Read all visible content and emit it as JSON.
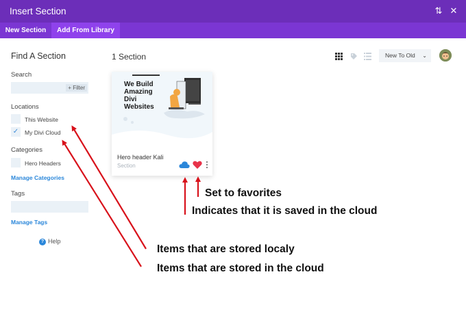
{
  "window": {
    "title": "Insert Section",
    "sort_icon": "⇅",
    "close_icon": "✕"
  },
  "tabs": [
    {
      "label": "New Section"
    },
    {
      "label": "Add From Library"
    }
  ],
  "sidebar": {
    "title": "Find A Section",
    "search_label": "Search",
    "search_value": "",
    "filter_label": "+ Filter",
    "locations_label": "Locations",
    "locations": [
      {
        "label": "This Website",
        "checked": false
      },
      {
        "label": "My Divi Cloud",
        "checked": true
      }
    ],
    "categories_label": "Categories",
    "categories": [
      {
        "label": "Hero Headers",
        "checked": false
      }
    ],
    "manage_categories": "Manage Categories",
    "tags_label": "Tags",
    "tags_value": "",
    "manage_tags": "Manage Tags",
    "help_label": "Help"
  },
  "main": {
    "count": "1 Section",
    "sort_selected": "New To Old",
    "cards": [
      {
        "thumbnail_heading": [
          "We Build",
          "Amazing",
          "Divi",
          "Websites"
        ],
        "name": "Hero header Kali",
        "type": "Section",
        "saved_in_cloud": true,
        "favorite": true
      }
    ]
  },
  "annotations": {
    "favorites": "Set to favorites",
    "cloud_saved": "Indicates that it is saved in the cloud",
    "stored_locally": "Items that are stored localy",
    "stored_cloud": "Items that are stored in the cloud"
  },
  "colors": {
    "titlebar": "#6c2eb9",
    "tabbar": "#7b36d3",
    "active_tab": "#8f42ec",
    "link": "#2b87da",
    "cloud": "#2b87da",
    "heart": "#e8334a",
    "arrow": "#d8121b"
  }
}
